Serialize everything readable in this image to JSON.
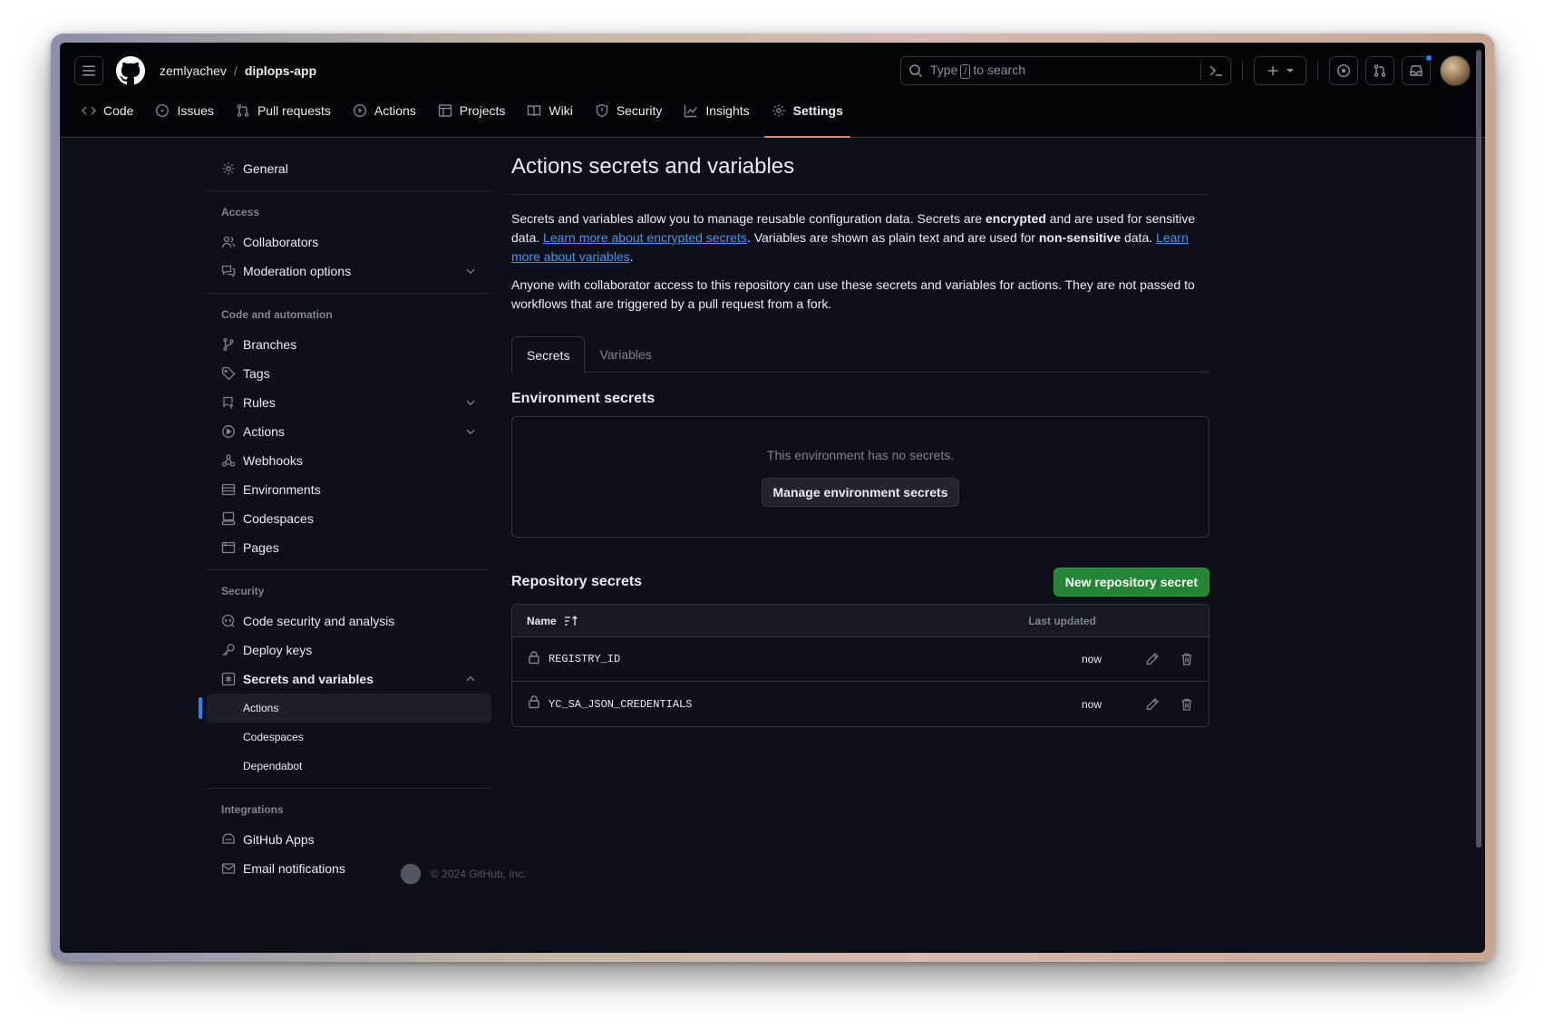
{
  "header": {
    "owner": "zemlyachev",
    "separator": "/",
    "repo": "diplops-app",
    "search_prefix": "Type",
    "search_key": "/",
    "search_suffix": "to search"
  },
  "repo_tabs": [
    {
      "label": "Code",
      "icon": "code-icon"
    },
    {
      "label": "Issues",
      "icon": "issue-icon"
    },
    {
      "label": "Pull requests",
      "icon": "pull-request-icon"
    },
    {
      "label": "Actions",
      "icon": "play-icon"
    },
    {
      "label": "Projects",
      "icon": "table-icon"
    },
    {
      "label": "Wiki",
      "icon": "book-icon"
    },
    {
      "label": "Security",
      "icon": "shield-icon"
    },
    {
      "label": "Insights",
      "icon": "graph-icon"
    },
    {
      "label": "Settings",
      "icon": "gear-icon",
      "selected": true
    }
  ],
  "sidebar": {
    "general": "General",
    "access_heading": "Access",
    "access": [
      "Collaborators",
      "Moderation options"
    ],
    "code_heading": "Code and automation",
    "code": [
      "Branches",
      "Tags",
      "Rules",
      "Actions",
      "Webhooks",
      "Environments",
      "Codespaces",
      "Pages"
    ],
    "security_heading": "Security",
    "security": [
      "Code security and analysis",
      "Deploy keys",
      "Secrets and variables"
    ],
    "secrets_sub": [
      "Actions",
      "Codespaces",
      "Dependabot"
    ],
    "integrations_heading": "Integrations",
    "integrations": [
      "GitHub Apps",
      "Email notifications"
    ]
  },
  "main": {
    "title": "Actions secrets and variables",
    "desc_a": "Secrets and variables allow you to manage reusable configuration data. Secrets are ",
    "desc_b": "encrypted",
    "desc_c": " and are used for sensitive data. ",
    "link1": "Learn more about encrypted secrets",
    "desc_d": ". Variables are shown as plain text and are used for ",
    "desc_e": "non-sensitive",
    "desc_f": " data. ",
    "link2": "Learn more about variables",
    "desc_g": ".",
    "desc2": "Anyone with collaborator access to this repository can use these secrets and variables for actions. They are not passed to workflows that are triggered by a pull request from a fork.",
    "tabs": [
      "Secrets",
      "Variables"
    ],
    "env_title": "Environment secrets",
    "env_empty": "This environment has no secrets.",
    "env_button": "Manage environment secrets",
    "repo_title": "Repository secrets",
    "new_button": "New repository secret",
    "col_name": "Name",
    "col_updated": "Last updated",
    "secrets": [
      {
        "name": "REGISTRY_ID",
        "updated": "now"
      },
      {
        "name": "YC_SA_JSON_CREDENTIALS",
        "updated": "now"
      }
    ]
  },
  "footer": {
    "text": "© 2024 GitHub, Inc."
  },
  "colors": {
    "accent": "#2f81f7",
    "green": "#238636",
    "tab_underline": "#f78166",
    "bg": "#0d1117"
  }
}
